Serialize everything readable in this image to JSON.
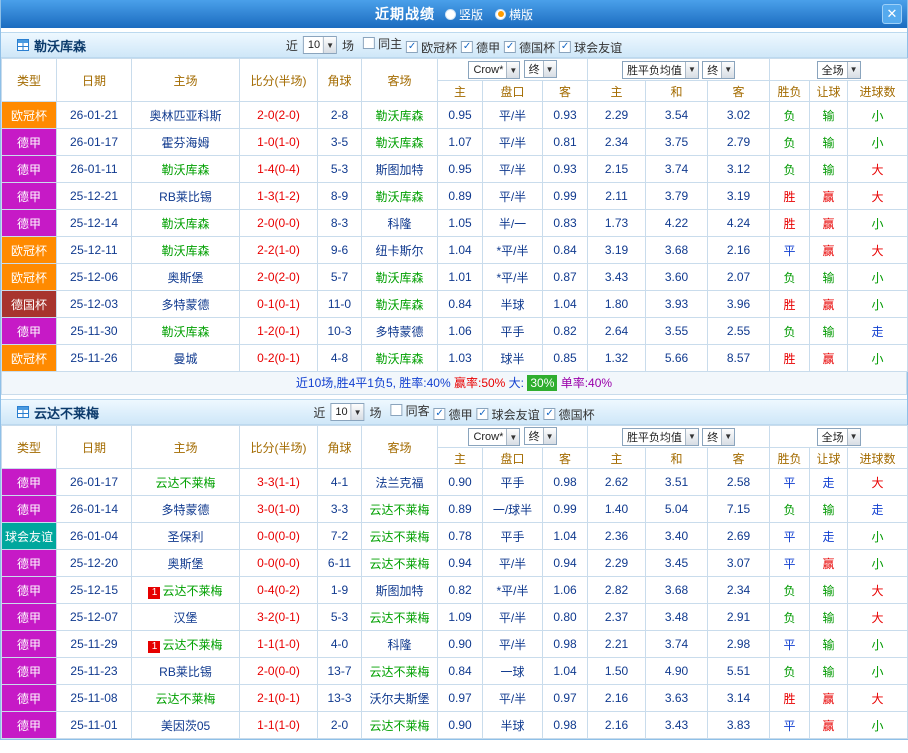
{
  "title_bar": {
    "title": "近期战绩",
    "options": [
      {
        "label": "竖版",
        "selected": false
      },
      {
        "label": "横版",
        "selected": true
      }
    ],
    "close_label": "✕"
  },
  "table_head": {
    "cols": [
      "类型",
      "日期",
      "主场",
      "比分(半场)",
      "角球",
      "客场"
    ],
    "odds_select": "Crow*",
    "final_select": "终",
    "odds_cols": [
      "主",
      "盘口",
      "客"
    ],
    "avg_select": "胜平负均值",
    "avg_cols": [
      "主",
      "和",
      "客"
    ],
    "scope_select": "全场",
    "result_cols": [
      "胜负",
      "让球",
      "进球数"
    ]
  },
  "colors": {
    "league": {
      "欧冠杯": "#ff8a00",
      "德甲": "#c61ac6",
      "德国杯": "#a8342e",
      "球会友谊": "#00a79d"
    },
    "result": {
      "胜": "#e80000",
      "赢": "#e80000",
      "大": "#e80000",
      "负": "#009a00",
      "输": "#009a00",
      "小": "#009a00",
      "平": "#1240d0",
      "走": "#1240d0"
    },
    "focus_team": "#00a000",
    "team": "#103a8f",
    "score": "#e80000",
    "number": "#103a8f"
  },
  "sections": [
    {
      "team": "勒沃库森",
      "filter": {
        "prefix": "近",
        "count": "10",
        "suffix": "场",
        "checks": [
          {
            "label": "同主",
            "checked": false
          },
          {
            "label": "欧冠杯",
            "checked": true
          },
          {
            "label": "德甲",
            "checked": true
          },
          {
            "label": "德国杯",
            "checked": true
          },
          {
            "label": "球会友谊",
            "checked": true
          }
        ]
      },
      "rows": [
        {
          "league": "欧冠杯",
          "date": "26-01-21",
          "home": "奥林匹亚科斯",
          "home_focus": false,
          "score": "2-0(2-0)",
          "corners": "2-8",
          "away": "勒沃库森",
          "away_focus": true,
          "odds": [
            "0.95",
            "平/半",
            "0.93"
          ],
          "avg": [
            "2.29",
            "3.54",
            "3.02"
          ],
          "results": [
            "负",
            "输",
            "小"
          ]
        },
        {
          "league": "德甲",
          "date": "26-01-17",
          "home": "霍芬海姆",
          "home_focus": false,
          "score": "1-0(1-0)",
          "corners": "3-5",
          "away": "勒沃库森",
          "away_focus": true,
          "odds": [
            "1.07",
            "平/半",
            "0.81"
          ],
          "avg": [
            "2.34",
            "3.75",
            "2.79"
          ],
          "results": [
            "负",
            "输",
            "小"
          ]
        },
        {
          "league": "德甲",
          "date": "26-01-11",
          "home": "勒沃库森",
          "home_focus": true,
          "score": "1-4(0-4)",
          "corners": "5-3",
          "away": "斯图加特",
          "away_focus": false,
          "odds": [
            "0.95",
            "平/半",
            "0.93"
          ],
          "avg": [
            "2.15",
            "3.74",
            "3.12"
          ],
          "results": [
            "负",
            "输",
            "大"
          ]
        },
        {
          "league": "德甲",
          "date": "25-12-21",
          "home": "RB莱比锡",
          "home_focus": false,
          "score": "1-3(1-2)",
          "corners": "8-9",
          "away": "勒沃库森",
          "away_focus": true,
          "odds": [
            "0.89",
            "平/半",
            "0.99"
          ],
          "avg": [
            "2.11",
            "3.79",
            "3.19"
          ],
          "results": [
            "胜",
            "赢",
            "大"
          ]
        },
        {
          "league": "德甲",
          "date": "25-12-14",
          "home": "勒沃库森",
          "home_focus": true,
          "score": "2-0(0-0)",
          "corners": "8-3",
          "away": "科隆",
          "away_focus": false,
          "odds": [
            "1.05",
            "半/一",
            "0.83"
          ],
          "avg": [
            "1.73",
            "4.22",
            "4.24"
          ],
          "results": [
            "胜",
            "赢",
            "小"
          ]
        },
        {
          "league": "欧冠杯",
          "date": "25-12-11",
          "home": "勒沃库森",
          "home_focus": true,
          "score": "2-2(1-0)",
          "corners": "9-6",
          "away": "纽卡斯尔",
          "away_focus": false,
          "odds": [
            "1.04",
            "*平/半",
            "0.84"
          ],
          "avg": [
            "3.19",
            "3.68",
            "2.16"
          ],
          "results": [
            "平",
            "赢",
            "大"
          ]
        },
        {
          "league": "欧冠杯",
          "date": "25-12-06",
          "home": "奥斯堡",
          "home_focus": false,
          "score": "2-0(2-0)",
          "corners": "5-7",
          "away": "勒沃库森",
          "away_focus": true,
          "odds": [
            "1.01",
            "*平/半",
            "0.87"
          ],
          "avg": [
            "3.43",
            "3.60",
            "2.07"
          ],
          "results": [
            "负",
            "输",
            "小"
          ]
        },
        {
          "league": "德国杯",
          "date": "25-12-03",
          "home": "多特蒙德",
          "home_focus": false,
          "score": "0-1(0-1)",
          "corners": "11-0",
          "away": "勒沃库森",
          "away_focus": true,
          "odds": [
            "0.84",
            "半球",
            "1.04"
          ],
          "avg": [
            "1.80",
            "3.93",
            "3.96"
          ],
          "results": [
            "胜",
            "赢",
            "小"
          ]
        },
        {
          "league": "德甲",
          "date": "25-11-30",
          "home": "勒沃库森",
          "home_focus": true,
          "score": "1-2(0-1)",
          "corners": "10-3",
          "away": "多特蒙德",
          "away_focus": false,
          "odds": [
            "1.06",
            "平手",
            "0.82"
          ],
          "avg": [
            "2.64",
            "3.55",
            "2.55"
          ],
          "results": [
            "负",
            "输",
            "走"
          ]
        },
        {
          "league": "欧冠杯",
          "date": "25-11-26",
          "home": "曼城",
          "home_focus": false,
          "score": "0-2(0-1)",
          "corners": "4-8",
          "away": "勒沃库森",
          "away_focus": true,
          "odds": [
            "1.03",
            "球半",
            "0.85"
          ],
          "avg": [
            "1.32",
            "5.66",
            "8.57"
          ],
          "results": [
            "胜",
            "赢",
            "小"
          ]
        }
      ],
      "summary": [
        {
          "text": "近10场,胜4平1负5, 胜率:40% ",
          "color": "#1240d0"
        },
        {
          "text": "赢率:50% ",
          "color": "#e80000"
        },
        {
          "text": "大: ",
          "color": "#1240d0"
        },
        {
          "text": "30%",
          "color": "#ffffff",
          "bg": "#2fae2f"
        },
        {
          "text": " 单率:40%",
          "color": "#9900aa"
        }
      ]
    },
    {
      "team": "云达不莱梅",
      "filter": {
        "prefix": "近",
        "count": "10",
        "suffix": "场",
        "checks": [
          {
            "label": "同客",
            "checked": false
          },
          {
            "label": "德甲",
            "checked": true
          },
          {
            "label": "球会友谊",
            "checked": true
          },
          {
            "label": "德国杯",
            "checked": true
          }
        ]
      },
      "rows": [
        {
          "league": "德甲",
          "date": "26-01-17",
          "home": "云达不莱梅",
          "home_focus": true,
          "score": "3-3(1-1)",
          "corners": "4-1",
          "away": "法兰克福",
          "away_focus": false,
          "odds": [
            "0.90",
            "平手",
            "0.98"
          ],
          "avg": [
            "2.62",
            "3.51",
            "2.58"
          ],
          "results": [
            "平",
            "走",
            "大"
          ]
        },
        {
          "league": "德甲",
          "date": "26-01-14",
          "home": "多特蒙德",
          "home_focus": false,
          "score": "3-0(1-0)",
          "corners": "3-3",
          "away": "云达不莱梅",
          "away_focus": true,
          "odds": [
            "0.89",
            "一/球半",
            "0.99"
          ],
          "avg": [
            "1.40",
            "5.04",
            "7.15"
          ],
          "results": [
            "负",
            "输",
            "走"
          ]
        },
        {
          "league": "球会友谊",
          "date": "26-01-04",
          "home": "圣保利",
          "home_focus": false,
          "score": "0-0(0-0)",
          "corners": "7-2",
          "away": "云达不莱梅",
          "away_focus": true,
          "odds": [
            "0.78",
            "平手",
            "1.04"
          ],
          "avg": [
            "2.36",
            "3.40",
            "2.69"
          ],
          "results": [
            "平",
            "走",
            "小"
          ]
        },
        {
          "league": "德甲",
          "date": "25-12-20",
          "home": "奥斯堡",
          "home_focus": false,
          "score": "0-0(0-0)",
          "corners": "6-11",
          "away": "云达不莱梅",
          "away_focus": true,
          "odds": [
            "0.94",
            "平/半",
            "0.94"
          ],
          "avg": [
            "2.29",
            "3.45",
            "3.07"
          ],
          "results": [
            "平",
            "赢",
            "小"
          ]
        },
        {
          "league": "德甲",
          "date": "25-12-15",
          "home": "云达不莱梅",
          "home_focus": true,
          "home_badge": "1",
          "score": "0-4(0-2)",
          "corners": "1-9",
          "away": "斯图加特",
          "away_focus": false,
          "odds": [
            "0.82",
            "*平/半",
            "1.06"
          ],
          "avg": [
            "2.82",
            "3.68",
            "2.34"
          ],
          "results": [
            "负",
            "输",
            "大"
          ]
        },
        {
          "league": "德甲",
          "date": "25-12-07",
          "home": "汉堡",
          "home_focus": false,
          "score": "3-2(0-1)",
          "corners": "5-3",
          "away": "云达不莱梅",
          "away_focus": true,
          "odds": [
            "1.09",
            "平/半",
            "0.80"
          ],
          "avg": [
            "2.37",
            "3.48",
            "2.91"
          ],
          "results": [
            "负",
            "输",
            "大"
          ]
        },
        {
          "league": "德甲",
          "date": "25-11-29",
          "home": "云达不莱梅",
          "home_focus": true,
          "home_badge": "1",
          "score": "1-1(1-0)",
          "corners": "4-0",
          "away": "科隆",
          "away_focus": false,
          "odds": [
            "0.90",
            "平/半",
            "0.98"
          ],
          "avg": [
            "2.21",
            "3.74",
            "2.98"
          ],
          "results": [
            "平",
            "输",
            "小"
          ]
        },
        {
          "league": "德甲",
          "date": "25-11-23",
          "home": "RB莱比锡",
          "home_focus": false,
          "score": "2-0(0-0)",
          "corners": "13-7",
          "away": "云达不莱梅",
          "away_focus": true,
          "odds": [
            "0.84",
            "一球",
            "1.04"
          ],
          "avg": [
            "1.50",
            "4.90",
            "5.51"
          ],
          "results": [
            "负",
            "输",
            "小"
          ]
        },
        {
          "league": "德甲",
          "date": "25-11-08",
          "home": "云达不莱梅",
          "home_focus": true,
          "score": "2-1(0-1)",
          "corners": "13-3",
          "away": "沃尔夫斯堡",
          "away_focus": false,
          "odds": [
            "0.97",
            "平/半",
            "0.97"
          ],
          "avg": [
            "2.16",
            "3.63",
            "3.14"
          ],
          "results": [
            "胜",
            "赢",
            "大"
          ]
        },
        {
          "league": "德甲",
          "date": "25-11-01",
          "home": "美因茨05",
          "home_focus": false,
          "score": "1-1(1-0)",
          "corners": "2-0",
          "away": "云达不莱梅",
          "away_focus": true,
          "odds": [
            "0.90",
            "半球",
            "0.98"
          ],
          "avg": [
            "2.16",
            "3.43",
            "3.83"
          ],
          "results": [
            "平",
            "赢",
            "小"
          ]
        }
      ],
      "summary": []
    }
  ]
}
